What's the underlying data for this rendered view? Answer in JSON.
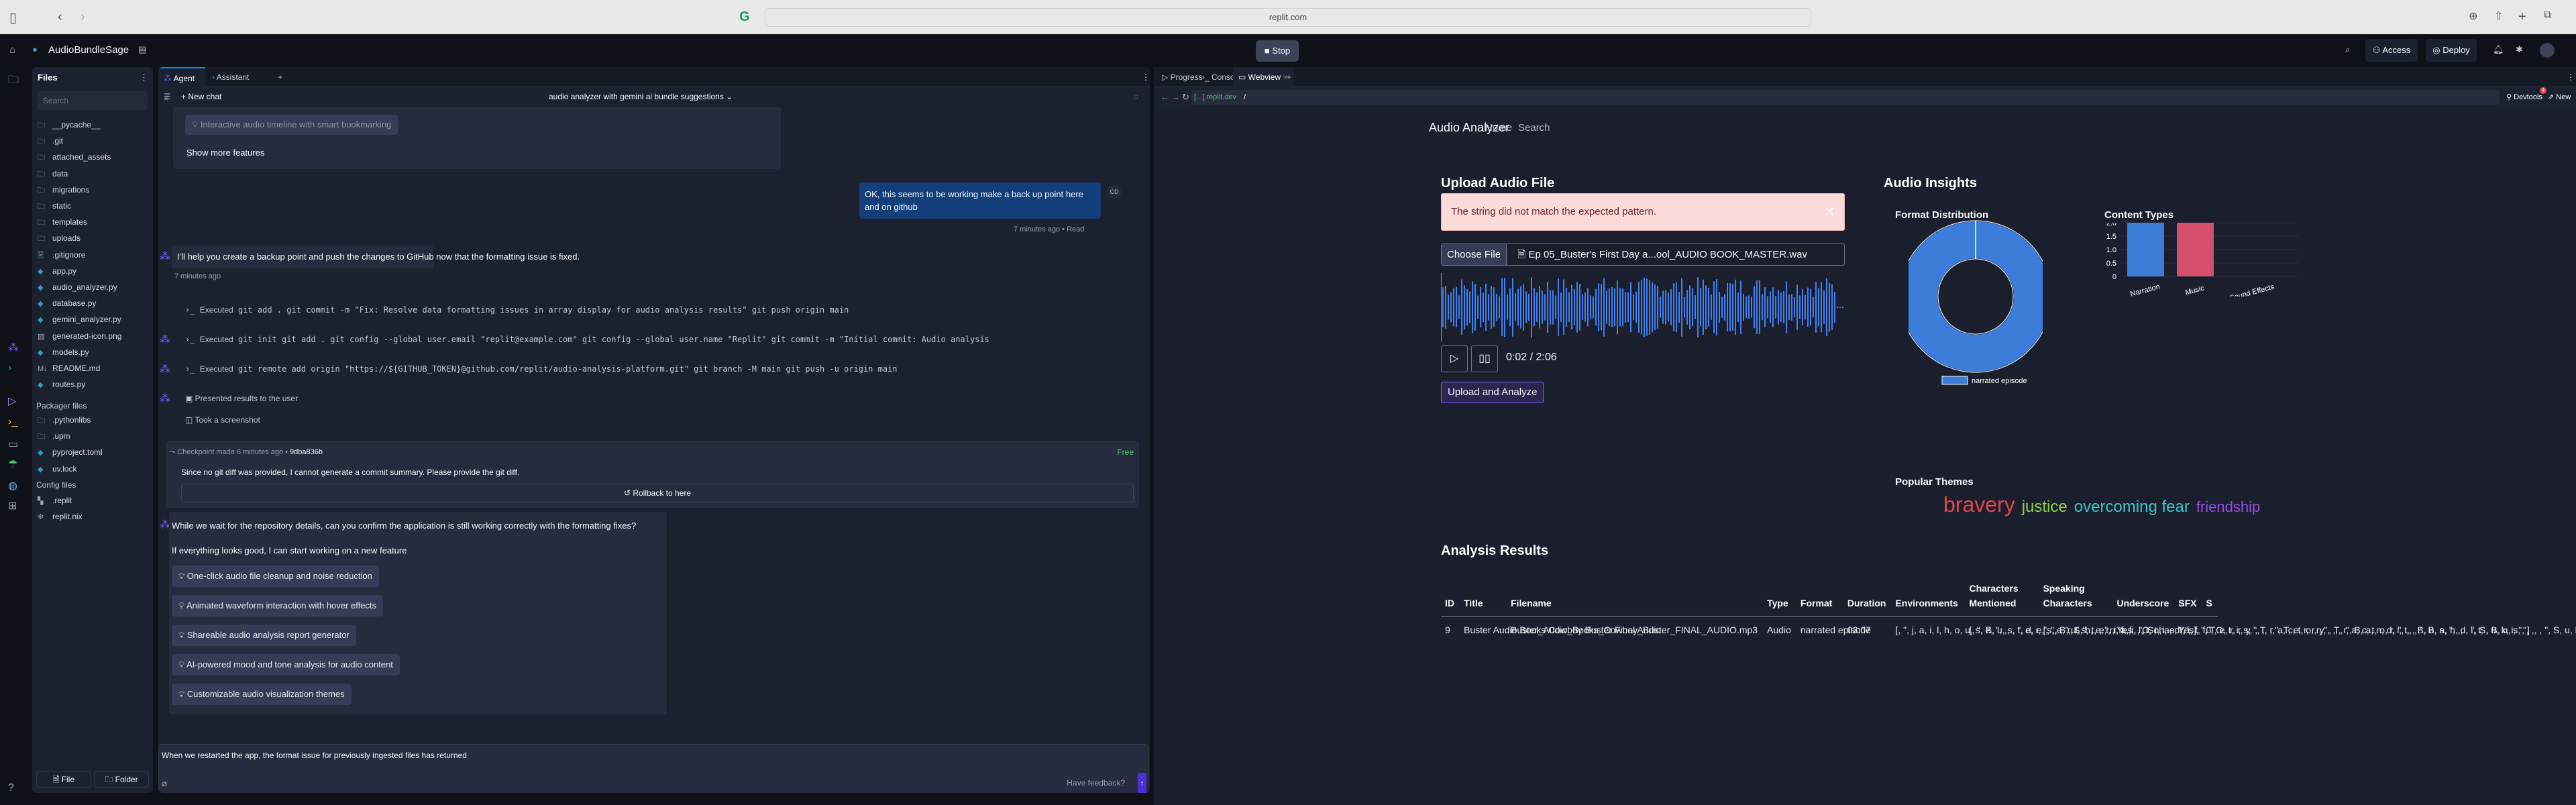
{
  "browser": {
    "url": "replit.com"
  },
  "topbar": {
    "project": "AudioBundleSage",
    "stop": "Stop",
    "access": "Access",
    "deploy": "Deploy"
  },
  "files": {
    "title": "Files",
    "search_placeholder": "Search",
    "items": [
      {
        "name": "__pycache__",
        "type": "folder"
      },
      {
        "name": ".git",
        "type": "folder"
      },
      {
        "name": "attached_assets",
        "type": "folder"
      },
      {
        "name": "data",
        "type": "folder"
      },
      {
        "name": "migrations",
        "type": "folder"
      },
      {
        "name": "static",
        "type": "folder"
      },
      {
        "name": "templates",
        "type": "folder"
      },
      {
        "name": "uploads",
        "type": "folder"
      },
      {
        "name": ".gitignore",
        "type": "file"
      },
      {
        "name": "app.py",
        "type": "python"
      },
      {
        "name": "audio_analyzer.py",
        "type": "python"
      },
      {
        "name": "database.py",
        "type": "python"
      },
      {
        "name": "gemini_analyzer.py",
        "type": "python"
      },
      {
        "name": "generated-icon.png",
        "type": "image"
      },
      {
        "name": "models.py",
        "type": "python"
      },
      {
        "name": "README.md",
        "type": "markdown"
      },
      {
        "name": "routes.py",
        "type": "python"
      }
    ],
    "packager_title": "Packager files",
    "packager": [
      {
        "name": ".pythonlibs",
        "type": "folder"
      },
      {
        "name": ".upm",
        "type": "folder"
      },
      {
        "name": "pyproject.toml",
        "type": "python"
      },
      {
        "name": "uv.lock",
        "type": "python"
      }
    ],
    "config_title": "Config files",
    "config": [
      {
        "name": ".replit",
        "type": "replit"
      },
      {
        "name": "replit.nix",
        "type": "nix"
      }
    ],
    "new_file": "File",
    "new_folder": "Folder"
  },
  "agent": {
    "tabs": [
      "Agent",
      "Assistant"
    ],
    "new_chat": "New chat",
    "chat_title": "audio analyzer with gemini ai bundle suggestions",
    "prev_feature": "Interactive audio timeline with smart bookmarking",
    "show_more": "Show more features",
    "user_msg": "OK, this seems to be working make a back up point here and on github",
    "user_initials": "CD",
    "user_time": "7 minutes ago",
    "user_read": "Read",
    "agent_msg": "I'll help you create a backup point and push the changes to GitHub now that the formatting issue is fixed.",
    "agent_time": "7 minutes ago",
    "executed_label": "Executed",
    "commands": [
      "git add . git commit -m \"Fix: Resolve data formatting issues in array display for audio analysis results\" git push origin main",
      "git init git add . git config --global user.email \"replit@example.com\" git config --global user.name \"Replit\" git commit -m \"Initial commit: Audio analysis",
      "git remote add origin \"https://${GITHUB_TOKEN}@github.com/replit/audio-analysis-platform.git\" git branch -M main git push -u origin main"
    ],
    "presented": "Presented results to the user",
    "screenshot": "Took a screenshot",
    "checkpoint": {
      "label": "Checkpoint made",
      "time": "6 minutes ago",
      "hash": "9dba836b",
      "price": "Free",
      "summary": "Since no git diff was provided, I cannot generate a commit summary. Please provide the git diff.",
      "rollback": "Rollback to here"
    },
    "question": "While we wait for the repository details, can you confirm the application is still working correctly with the formatting fixes?",
    "followup": "If everything looks good, I can start working on a new feature",
    "features": [
      "One-click audio file cleanup and noise reduction",
      "Animated waveform interaction with hover effects",
      "Shareable audio analysis report generator",
      "AI-powered mood and tone analysis for audio content",
      "Customizable audio visualization themes"
    ],
    "input_value": "When we restarted the app, the format issue for previously ingested files has returned",
    "feedback": "Have feedback?"
  },
  "right": {
    "tabs": [
      "Progress",
      "Console",
      "Webview"
    ],
    "url_host": "[...].replit.dev",
    "url_path": "/",
    "devtools": "Devtools",
    "devtools_badge": "4",
    "new_tab": "New tab"
  },
  "app": {
    "brand": "Audio Analyzer",
    "nav": [
      "Home",
      "Search"
    ],
    "upload_title": "Upload Audio File",
    "error": "The string did not match the expected pattern.",
    "choose_file": "Choose File",
    "file_name": "Ep 05_Buster's First Day a...ool_AUDIO BOOK_MASTER.wav",
    "time": "0:02 / 2:06",
    "upload_button": "Upload and Analyze",
    "insights_title": "Audio Insights",
    "themes_title": "Popular Themes",
    "themes": [
      {
        "word": "bravery",
        "color": "#e0474c"
      },
      {
        "word": "justice",
        "color": "#8fd14f"
      },
      {
        "word": "overcoming fear",
        "color": "#3cc7c7"
      },
      {
        "word": "friendship",
        "color": "#9b4de0"
      }
    ],
    "results_title": "Analysis Results",
    "columns": [
      "ID",
      "Title",
      "Filename",
      "Type",
      "Format",
      "Duration",
      "Environments",
      "Characters Mentioned",
      "Speaking Characters",
      "Underscore",
      "SFX",
      "S"
    ],
    "rows": [
      [
        "9",
        "Buster Audio Books Cowboy Buster Final Audio",
        "Buster_Audio_Books_Cowboy_Buster_FINAL_AUDIO.mp3",
        "Audio",
        "narrated episode",
        "03:07",
        "[, \", j, a, i, l, h, o, u, s, e, \", ,, , \", d, e, s, e, r, t, \", ,, , \", r, a, i, l, r, o, a, d, \", ]",
        "[, \", B, u, s, t, e, r, \", ,, , \", S, h, e, r, i, f, f, , O, t, i, s, \", ,, , \", T, e, r, r, y, , T, r, a, c, t, o, r, \", ,, , \", B, a, n, d, i, t, , B, u, s, \", ,, , \", S, u, k, i, \", ]",
        "[, \", B, u, s, t, e, r, \", ,, , \", S, h, e, r, i, f, f, , O, t, i, s, \", ,, , \", T, e, r, r, y, , T, r, a, c, t, o, r, \", ,, , \", B, a, n, d, i, t, , B, u, s, \", ,, , \", S, u, k, i, \", ]",
        "Yes",
        "Yes",
        "0"
      ]
    ]
  },
  "chart_data": [
    {
      "type": "pie",
      "title": "Format Distribution",
      "donut": true,
      "slices": [
        {
          "label": "narrated episode",
          "value": 1,
          "color": "#3b7dd8"
        }
      ],
      "legend": "bottom"
    },
    {
      "type": "bar",
      "title": "Content Types",
      "categories": [
        "Narration",
        "Music",
        "Sound Effects"
      ],
      "values": [
        2,
        2,
        0
      ],
      "colors": [
        "#3b7dd8",
        "#d44f6b",
        "#3b7dd8"
      ],
      "ylim": [
        0,
        2
      ],
      "yticks": [
        "0",
        "0.5",
        "1.0",
        "1.5",
        "2.0"
      ],
      "grid": true
    }
  ]
}
